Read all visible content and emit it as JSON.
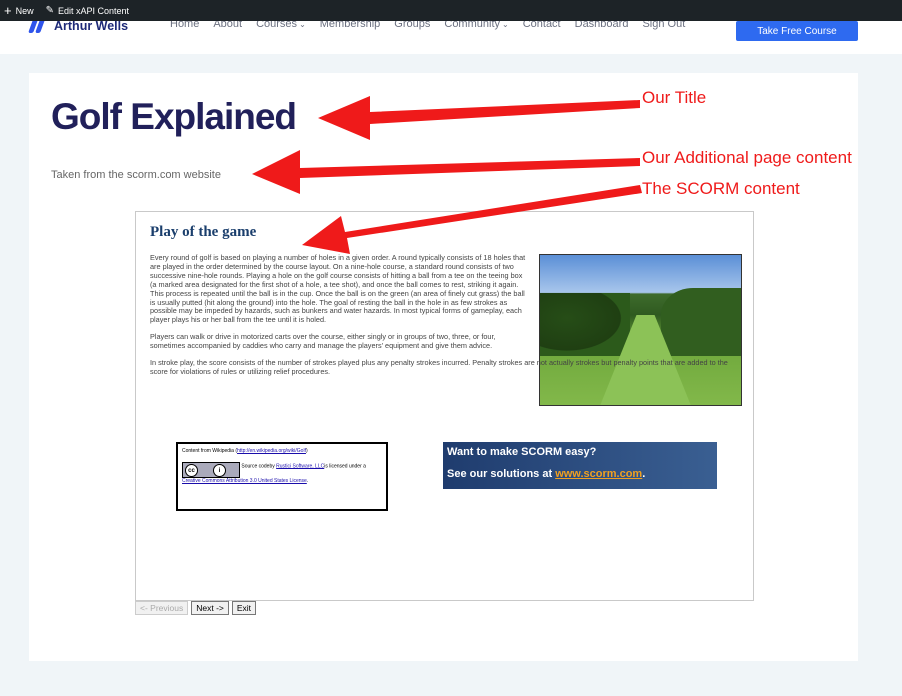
{
  "admin_bar": {
    "new_label": "New",
    "edit_label": "Edit xAPI Content"
  },
  "header": {
    "logo_text": "Arthur Wells",
    "nav": [
      {
        "label": "Home",
        "dropdown": false
      },
      {
        "label": "About",
        "dropdown": false
      },
      {
        "label": "Courses",
        "dropdown": true
      },
      {
        "label": "Membership",
        "dropdown": false
      },
      {
        "label": "Groups",
        "dropdown": false
      },
      {
        "label": "Community",
        "dropdown": true
      },
      {
        "label": "Contact",
        "dropdown": false
      },
      {
        "label": "Dashboard",
        "dropdown": false
      },
      {
        "label": "Sign Out",
        "dropdown": false
      }
    ],
    "cta_label": "Take Free Course"
  },
  "page": {
    "title": "Golf Explained",
    "subtitle": "Taken from the scorm.com website"
  },
  "scorm": {
    "heading": "Play of the game",
    "paragraphs": [
      "Every round of golf is based on playing a number of holes in a given order. A round typically consists of 18 holes that are played in the order determined by the course layout. On a nine-hole course, a standard round consists of two successive nine-hole rounds. Playing a hole on the golf course consists of hitting a ball from a tee on the teeing box (a marked area designated for the first shot of a hole, a tee shot), and once the ball comes to rest, striking it again. This process is repeated until the ball is in the cup. Once the ball is on the green (an area of finely cut grass) the ball is usually putted (hit along the ground) into the hole. The goal of resting the ball in the hole in as few strokes as possible may be impeded by hazards, such as bunkers and water hazards. In most typical forms of gameplay, each player plays his or her ball from the tee until it is holed.",
      "Players can walk or drive in motorized carts over the course, either singly or in groups of two, three, or four, sometimes accompanied by caddies who carry and manage the players' equipment and give them advice.",
      "In stroke play, the score consists of the number of strokes played plus any penalty strokes incurred. Penalty strokes are not actually strokes but penalty points that are added to the score for violations of rules or utilizing relief procedures."
    ],
    "wiki_box": {
      "content_from": "Content from Wikipedia (",
      "wiki_link": "http://en.wikipedia.org/wiki/Golf",
      "close": ")",
      "source_code_by": "Source codeby ",
      "rustici_link": "Rustici Software, LLC",
      "licensed": "is licensed under a ",
      "license_link": "Creative Commons Attribution 3.0 United States License",
      "period": "."
    },
    "ad": {
      "line1": "Want to make SCORM easy?",
      "line2_prefix": "See our solutions at ",
      "line2_link": "www.scorm.com",
      "line2_suffix": "."
    },
    "buttons": {
      "previous": "<- Previous",
      "next": "Next ->",
      "exit": "Exit"
    }
  },
  "annotations": {
    "title": "Our Title",
    "additional": "Our Additional page content",
    "scorm": "The SCORM content",
    "color": "#ef1a1a"
  }
}
